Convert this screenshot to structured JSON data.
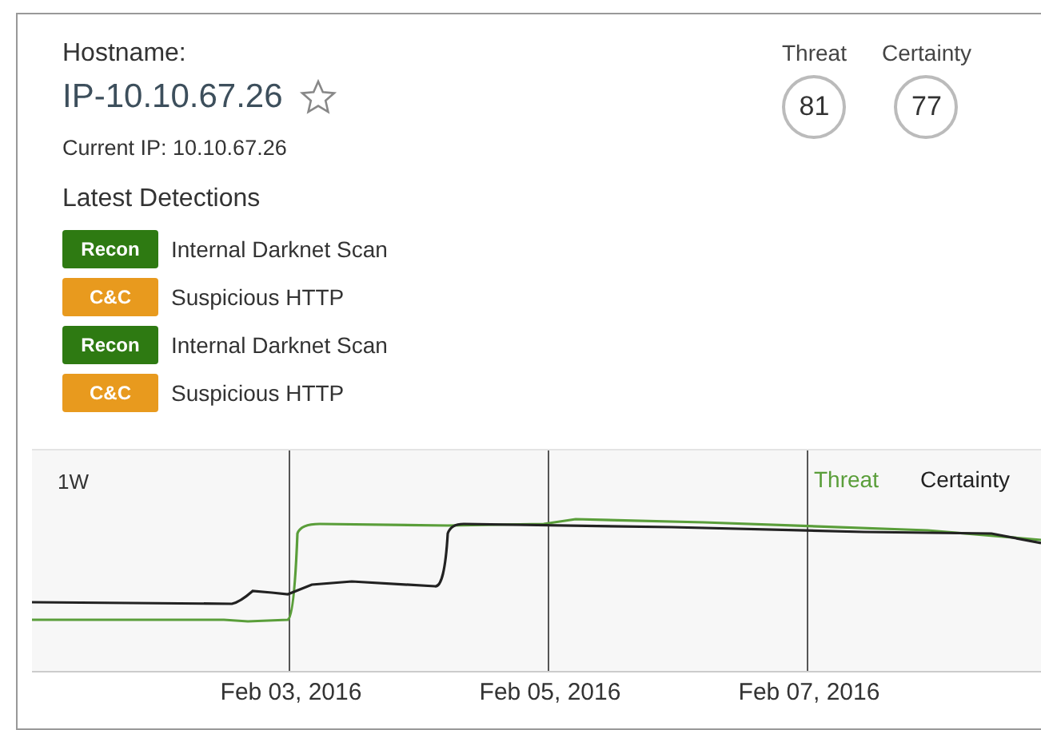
{
  "host": {
    "label": "Hostname:",
    "name": "IP-10.10.67.26",
    "starred": false,
    "current_ip": "Current IP: 10.10.67.26"
  },
  "scores": [
    {
      "label": "Threat",
      "value": "81"
    },
    {
      "label": "Certainty",
      "value": "77"
    }
  ],
  "detections_title": "Latest Detections",
  "detections": [
    {
      "tag": "Recon",
      "color": "#2e7a12",
      "name": "Internal Darknet Scan"
    },
    {
      "tag": "C&C",
      "color": "#e89a1e",
      "name": "Suspicious HTTP"
    },
    {
      "tag": "Recon",
      "color": "#2e7a12",
      "name": "Internal Darknet Scan"
    },
    {
      "tag": "C&C",
      "color": "#e89a1e",
      "name": "Suspicious HTTP"
    }
  ],
  "chart": {
    "range": "1W",
    "legend": [
      {
        "label": "Threat",
        "color": "#5a9e3a"
      },
      {
        "label": "Certainty",
        "color": "#222222"
      }
    ],
    "dates": [
      "Feb 03, 2016",
      "Feb 05, 2016",
      "Feb 07, 2016"
    ]
  }
}
